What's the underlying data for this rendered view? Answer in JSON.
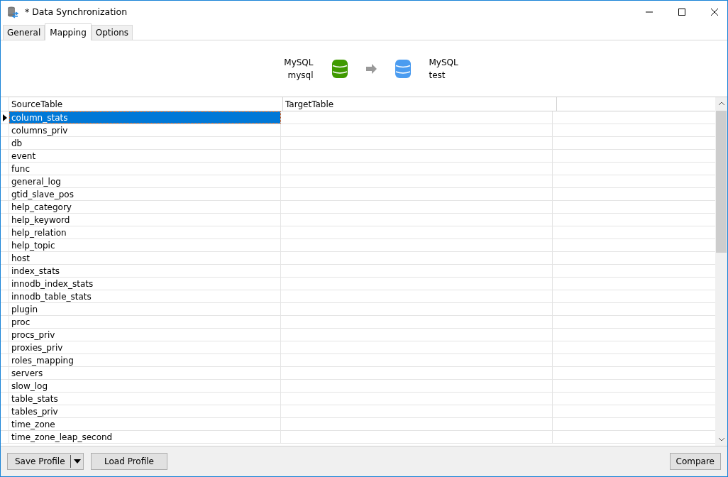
{
  "window": {
    "title": "* Data Synchronization"
  },
  "tabs": [
    {
      "label": "General",
      "selected": false
    },
    {
      "label": "Mapping",
      "selected": true
    },
    {
      "label": "Options",
      "selected": false
    }
  ],
  "mapping": {
    "source": {
      "type": "MySQL",
      "database": "mysql"
    },
    "target": {
      "type": "MySQL",
      "database": "test"
    }
  },
  "table": {
    "columns": [
      "SourceTable",
      "TargetTable"
    ],
    "rows": [
      {
        "source": "column_stats",
        "selected": true
      },
      {
        "source": "columns_priv",
        "selected": false
      },
      {
        "source": "db",
        "selected": false
      },
      {
        "source": "event",
        "selected": false
      },
      {
        "source": "func",
        "selected": false
      },
      {
        "source": "general_log",
        "selected": false
      },
      {
        "source": "gtid_slave_pos",
        "selected": false
      },
      {
        "source": "help_category",
        "selected": false
      },
      {
        "source": "help_keyword",
        "selected": false
      },
      {
        "source": "help_relation",
        "selected": false
      },
      {
        "source": "help_topic",
        "selected": false
      },
      {
        "source": "host",
        "selected": false
      },
      {
        "source": "index_stats",
        "selected": false
      },
      {
        "source": "innodb_index_stats",
        "selected": false
      },
      {
        "source": "innodb_table_stats",
        "selected": false
      },
      {
        "source": "plugin",
        "selected": false
      },
      {
        "source": "proc",
        "selected": false
      },
      {
        "source": "procs_priv",
        "selected": false
      },
      {
        "source": "proxies_priv",
        "selected": false
      },
      {
        "source": "roles_mapping",
        "selected": false
      },
      {
        "source": "servers",
        "selected": false
      },
      {
        "source": "slow_log",
        "selected": false
      },
      {
        "source": "table_stats",
        "selected": false
      },
      {
        "source": "tables_priv",
        "selected": false
      },
      {
        "source": "time_zone",
        "selected": false
      },
      {
        "source": "time_zone_leap_second",
        "selected": false
      }
    ]
  },
  "buttons": {
    "save": "Save Profile",
    "load": "Load Profile",
    "compare": "Compare"
  }
}
